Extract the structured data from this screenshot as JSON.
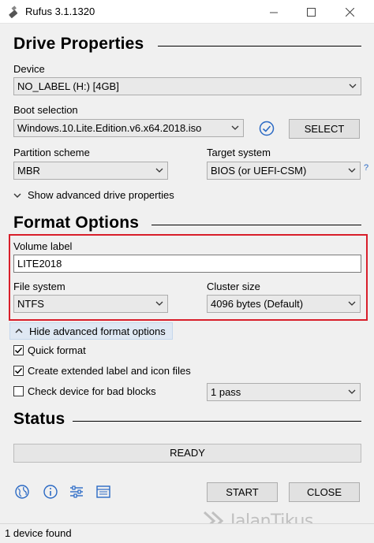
{
  "window": {
    "title": "Rufus 3.1.1320",
    "minimize_icon": "minimize-icon",
    "maximize_icon": "maximize-icon",
    "close_icon": "close-icon"
  },
  "drive_properties": {
    "heading": "Drive Properties",
    "device_label": "Device",
    "device_value": "NO_LABEL (H:) [4GB]",
    "boot_selection_label": "Boot selection",
    "boot_selection_value": "Windows.10.Lite.Edition.v6.x64.2018.iso",
    "select_button": "SELECT",
    "partition_scheme_label": "Partition scheme",
    "partition_scheme_value": "MBR",
    "target_system_label": "Target system",
    "target_system_value": "BIOS (or UEFI-CSM)",
    "help_mark": "?",
    "show_advanced": "Show advanced drive properties"
  },
  "format_options": {
    "heading": "Format Options",
    "volume_label_label": "Volume label",
    "volume_label_value": "LITE2018",
    "file_system_label": "File system",
    "file_system_value": "NTFS",
    "cluster_size_label": "Cluster size",
    "cluster_size_value": "4096 bytes (Default)",
    "hide_advanced": "Hide advanced format options",
    "quick_format": {
      "label": "Quick format",
      "checked": true
    },
    "extended_label": {
      "label": "Create extended label and icon files",
      "checked": true
    },
    "bad_blocks": {
      "label": "Check device for bad blocks",
      "checked": false
    },
    "passes_value": "1 pass"
  },
  "status": {
    "heading": "Status",
    "progress_text": "READY",
    "start_button": "START",
    "close_button": "CLOSE",
    "footer": "1 device found"
  },
  "toolbar_icons": [
    "globe-icon",
    "info-icon",
    "settings-sliders-icon",
    "log-icon"
  ],
  "watermark": {
    "text": "JalanTikus"
  },
  "colors": {
    "highlight_border": "#d81e2a",
    "accent_blue": "#2a69c4"
  }
}
